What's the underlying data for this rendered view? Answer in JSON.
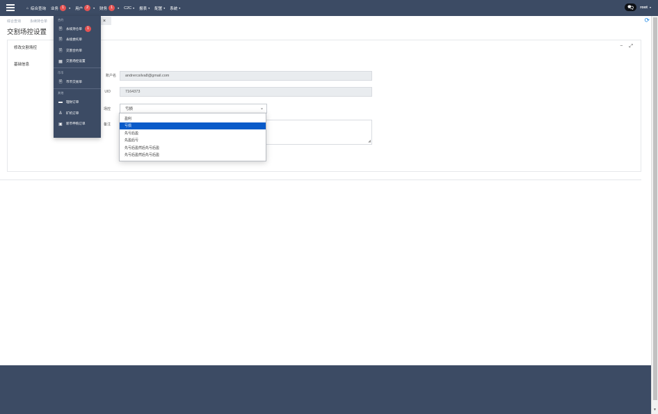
{
  "navbar": {
    "items": [
      {
        "label": "综合查询",
        "icon": "home-icon"
      },
      {
        "label": "业务",
        "badge": "1"
      },
      {
        "label": "用户",
        "badge": "2"
      },
      {
        "label": "财务",
        "badge": "1"
      },
      {
        "label": "C2C"
      },
      {
        "label": "报表"
      },
      {
        "label": "配置"
      },
      {
        "label": "系统"
      }
    ],
    "chat_icon": "chat-icon",
    "user": "root"
  },
  "breadcrumb": [
    "综合查询",
    "永续持仓单"
  ],
  "page_title": "交割场控设置",
  "tab_close": "×",
  "card": {
    "title": "修改交割场控",
    "section_label": "基础信息",
    "tools": [
      "−",
      "⤢"
    ],
    "fields": {
      "account_label": "账户名",
      "account_value": "andrercsilva8@gmail.com",
      "uid_label": "UID",
      "uid_value": "7164373",
      "control_label": "场控",
      "control_value": "亏损",
      "remark_label": "备注"
    }
  },
  "dropdown_options": [
    {
      "label": "盈利",
      "selected": false
    },
    {
      "label": "亏损",
      "selected": true
    },
    {
      "label": "先亏后盈",
      "selected": false
    },
    {
      "label": "先盈后亏",
      "selected": false
    },
    {
      "label": "先亏后盈然后先亏后盈",
      "selected": false
    },
    {
      "label": "先亏后盈然后先亏后盈",
      "selected": false
    }
  ],
  "business_menu": {
    "groups": [
      {
        "title": "合约",
        "items": [
          {
            "label": "永续持仓单",
            "icon": "document-icon",
            "badge": "1"
          },
          {
            "label": "永续委托单",
            "icon": "document-icon"
          },
          {
            "label": "交割合约单",
            "icon": "document-icon"
          },
          {
            "label": "交割场控设置",
            "icon": "table-icon"
          }
        ]
      },
      {
        "title": "币币",
        "items": [
          {
            "label": "币币交易单",
            "icon": "document-icon"
          }
        ]
      },
      {
        "title": "其他",
        "items": [
          {
            "label": "理财订单",
            "icon": "folder-icon"
          },
          {
            "label": "矿机订单",
            "icon": "anchor-icon"
          },
          {
            "label": "新币申购订单",
            "icon": "clipboard-icon"
          }
        ]
      }
    ]
  },
  "colors": {
    "navbar": "#3c4b64",
    "badge": "#e55353",
    "selected_option": "#0a5bc9",
    "refresh": "#1e88e5"
  }
}
